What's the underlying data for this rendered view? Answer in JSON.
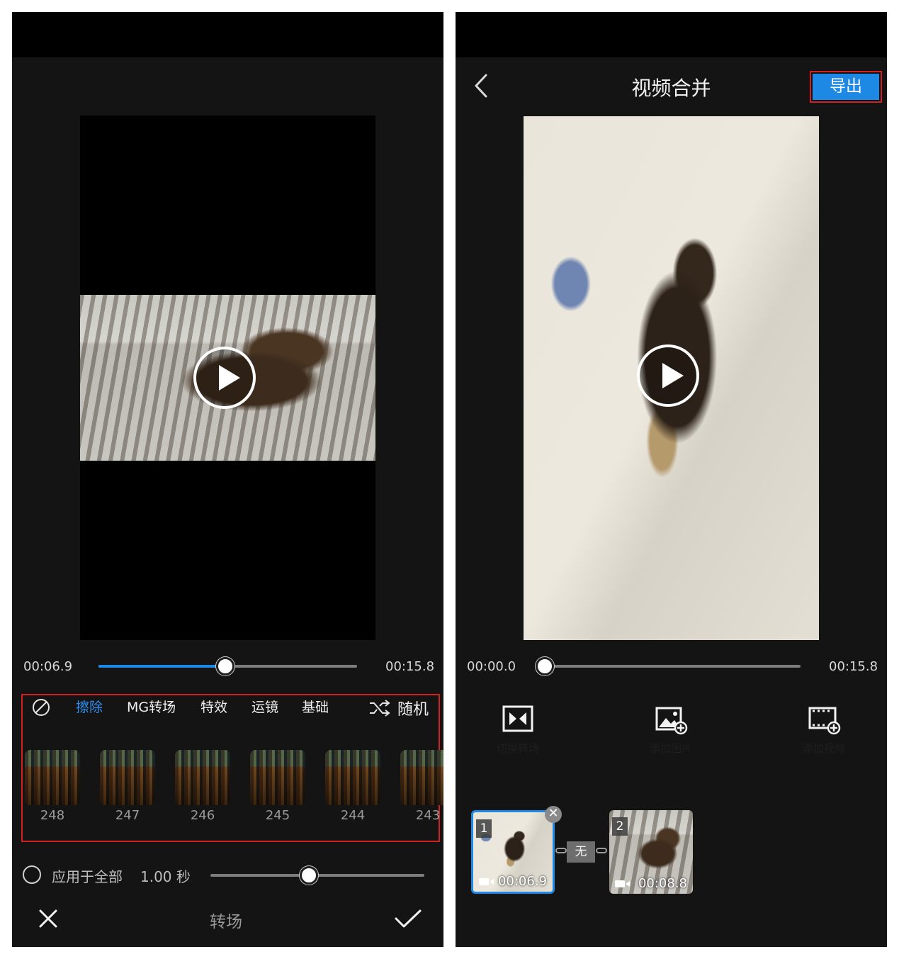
{
  "left": {
    "current_time": "00:06.9",
    "total_time": "00:15.8",
    "progress_fraction": 0.49,
    "tabs": [
      {
        "label": "擦除",
        "active": true
      },
      {
        "label": "MG转场",
        "active": false
      },
      {
        "label": "特效",
        "active": false
      },
      {
        "label": "运镜",
        "active": false
      },
      {
        "label": "基础",
        "active": false
      }
    ],
    "random_label": "随机",
    "transitions": [
      "248",
      "247",
      "246",
      "245",
      "244",
      "243"
    ],
    "apply_all_label": "应用于全部",
    "duration_value": "1.00 秒",
    "duration_fraction": 0.46,
    "footer_title": "转场"
  },
  "right": {
    "title": "视频合并",
    "export_label": "导出",
    "current_time": "00:00.0",
    "total_time": "00:15.8",
    "progress_fraction": 0.0,
    "actions": [
      {
        "label": "切换转场",
        "icon": "transition-icon"
      },
      {
        "label": "添加图片",
        "icon": "add-image-icon"
      },
      {
        "label": "添加视频",
        "icon": "add-video-icon"
      }
    ],
    "clips": [
      {
        "index": "1",
        "duration": "00:06.9",
        "selected": true
      },
      {
        "index": "2",
        "duration": "00:08.8",
        "selected": false
      }
    ],
    "transition_badge": "无"
  },
  "colors": {
    "accent": "#1e88e5",
    "highlight": "#d32020",
    "background": "#141414"
  }
}
